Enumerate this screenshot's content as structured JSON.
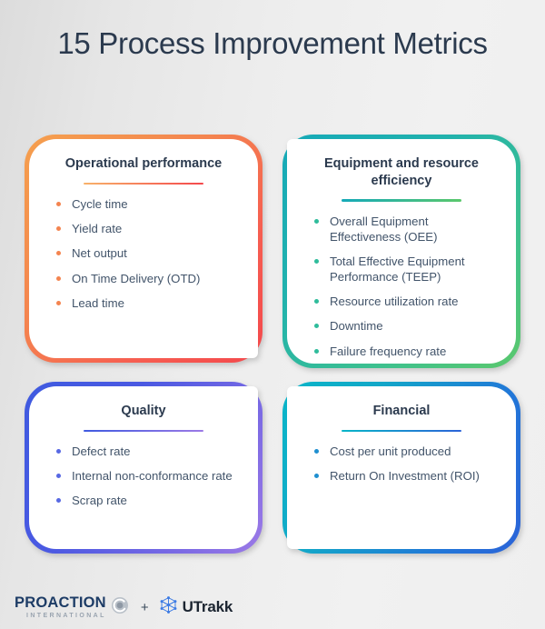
{
  "header": {
    "title": "15 Process Improvement Metrics"
  },
  "colors": {
    "title_text": "#2b3a4e",
    "body_text": "#42546a",
    "background_left": "#dcdcdc",
    "background_right": "#f1f1f1",
    "card_1_gradient_start": "#f5a04e",
    "card_1_gradient_end": "#f4484c",
    "card_2_gradient_start": "#15a9b8",
    "card_2_gradient_end": "#5bc86c",
    "card_3_gradient_start": "#3f5ae0",
    "card_3_gradient_end": "#9c7ae6",
    "card_4_gradient_start": "#09b5c8",
    "card_4_gradient_end": "#2b63d8"
  },
  "cards": [
    {
      "id": "operational-performance",
      "title": "Operational performance",
      "items": [
        "Cycle time",
        "Yield rate",
        "Net output",
        "On Time Delivery (OTD)",
        "Lead time"
      ]
    },
    {
      "id": "equipment-and-resource-efficiency",
      "title": "Equipment and resource efficiency",
      "items": [
        "Overall Equipment Effectiveness (OEE)",
        "Total Effective Equipment Performance (TEEP)",
        "Resource utilization rate",
        "Downtime",
        "Failure frequency rate"
      ]
    },
    {
      "id": "quality",
      "title": "Quality",
      "items": [
        "Defect rate",
        "Internal non-conformance rate",
        "Scrap rate"
      ]
    },
    {
      "id": "financial",
      "title": "Financial",
      "items": [
        "Cost per unit produced",
        "Return On Investment (ROI)"
      ]
    }
  ],
  "footer": {
    "proaction_name": "PROACTION",
    "proaction_sub": "INTERNATIONAL",
    "separator": "+",
    "utrakk_name": "UTrakk",
    "proaction_icon": "spiral-circle-icon",
    "utrakk_icon": "cube-network-icon"
  }
}
